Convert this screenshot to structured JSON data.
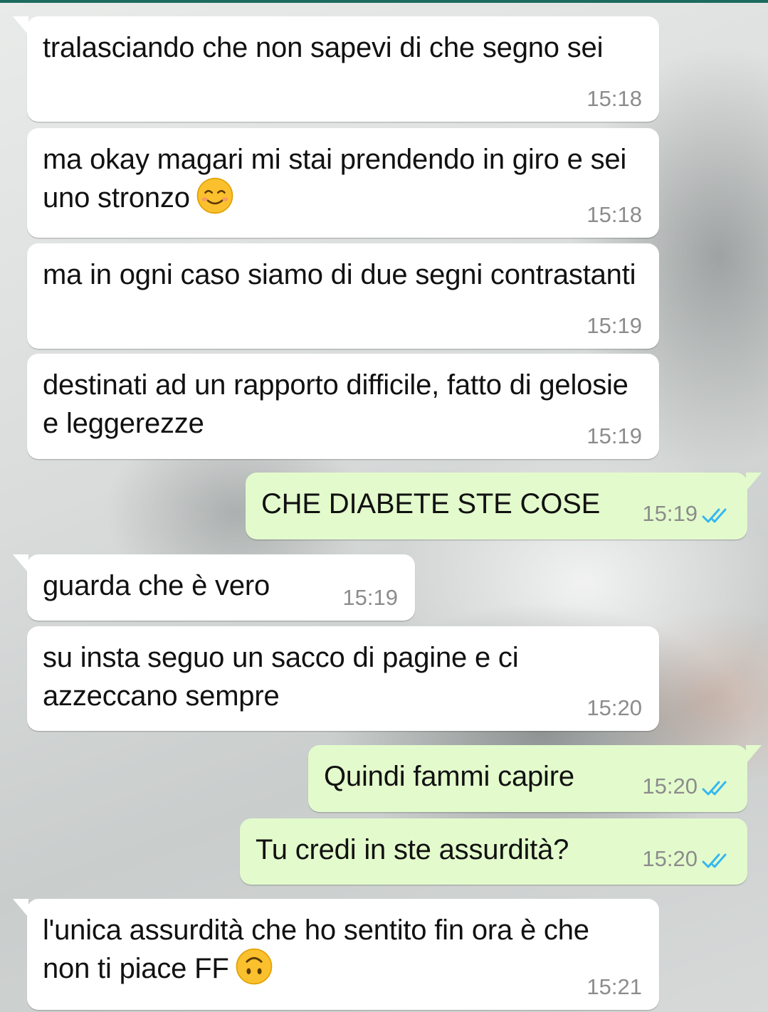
{
  "colors": {
    "incoming_bubble": "#ffffff",
    "outgoing_bubble": "#e3fbcc",
    "timestamp": "#8c8c8c",
    "read_ticks": "#34b7f1",
    "accent_top": "#1d6b5f"
  },
  "messages": [
    {
      "direction": "in",
      "text": "tralasciando che non sapevi di che segno sei",
      "time": "15:18"
    },
    {
      "direction": "in",
      "text": "ma okay magari mi stai prendendo in giro e sei uno stronzo",
      "emoji": "smiling-face-icon",
      "time": "15:18"
    },
    {
      "direction": "in",
      "text": "ma in ogni caso siamo di due segni contrastanti",
      "time": "15:19"
    },
    {
      "direction": "in",
      "text": "destinati ad un rapporto difficile, fatto di gelosie e leggerezze",
      "time": "15:19"
    },
    {
      "direction": "out",
      "text": "CHE DIABETE STE COSE",
      "time": "15:19",
      "status": "read-double-check-icon"
    },
    {
      "direction": "in",
      "text": "guarda che è vero",
      "time": "15:19"
    },
    {
      "direction": "in",
      "text": "su insta seguo un sacco di pagine e ci azzeccano sempre",
      "time": "15:20"
    },
    {
      "direction": "out",
      "text": "Quindi fammi capire",
      "time": "15:20",
      "status": "read-double-check-icon"
    },
    {
      "direction": "out",
      "text": "Tu credi in ste assurdità?",
      "time": "15:20",
      "status": "read-double-check-icon"
    },
    {
      "direction": "in",
      "text": "l'unica assurdità che ho sentito fin ora è che non ti piace FF",
      "emoji": "upside-down-face-icon",
      "time": "15:21"
    }
  ]
}
